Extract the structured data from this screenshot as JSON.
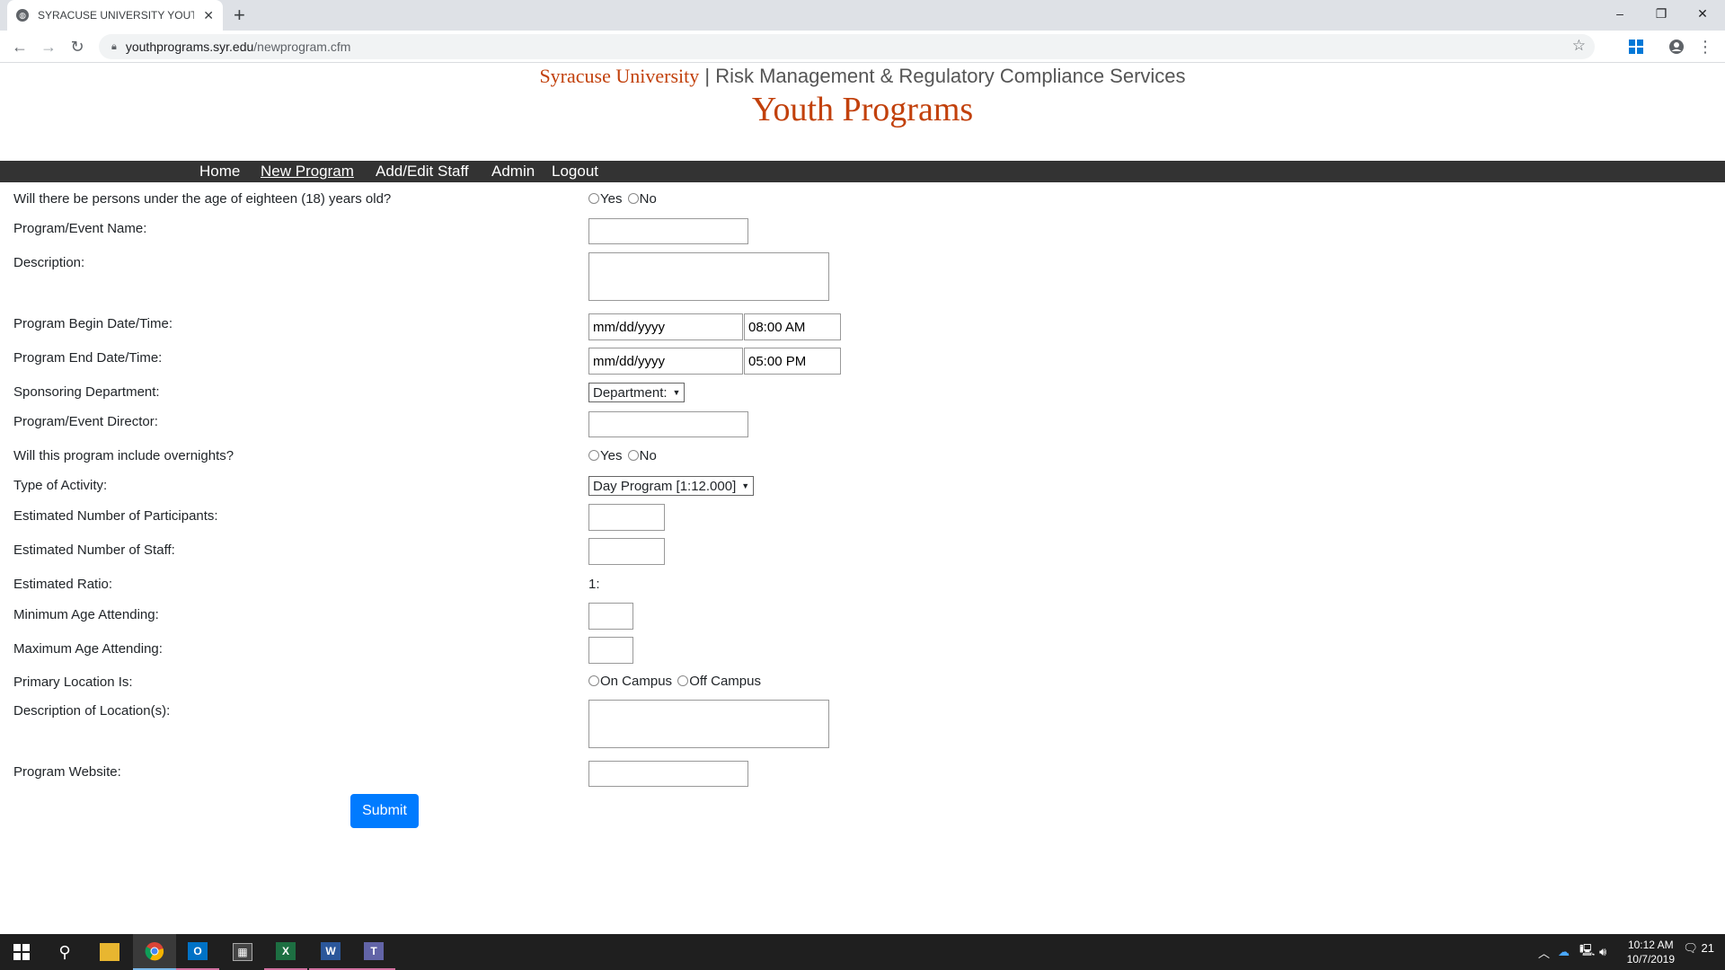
{
  "browser": {
    "tab_title": "SYRACUSE UNIVERSITY YOUTH P",
    "tab_close": "✕",
    "new_tab": "+",
    "url_host": "youthprograms.syr.edu",
    "url_path": "/newprogram.cfm",
    "window_controls": [
      "–",
      "❐",
      "✕"
    ]
  },
  "header": {
    "brand": "Syracuse University",
    "separator": "|",
    "department": "Risk Management & Regulatory Compliance Services",
    "title": "Youth Programs"
  },
  "nav": [
    "Home",
    "New Program",
    "Add/Edit Staff",
    "Admin",
    "Logout"
  ],
  "form": {
    "under18_label": "Will there be persons under the age of eighteen (18) years old?",
    "yes": "Yes",
    "no": "No",
    "program_name_label": "Program/Event Name:",
    "description_label": "Description:",
    "begin_label": "Program Begin Date/Time:",
    "begin_date": "mm/dd/yyyy",
    "begin_time": "08:00 AM",
    "end_label": "Program End Date/Time:",
    "end_date": "mm/dd/yyyy",
    "end_time": "05:00 PM",
    "sponsor_label": "Sponsoring Department:",
    "sponsor_value": "Department:",
    "director_label": "Program/Event Director:",
    "overnights_label": "Will this program include overnights?",
    "activity_label": "Type of Activity:",
    "activity_value": "Day Program [1:12.000]",
    "participants_label": "Estimated Number of Participants:",
    "staff_label": "Estimated Number of Staff:",
    "ratio_label": "Estimated Ratio:",
    "ratio_value": "1:",
    "min_age_label": "Minimum Age Attending:",
    "max_age_label": "Maximum Age Attending:",
    "location_label": "Primary Location Is:",
    "on_campus": "On Campus",
    "off_campus": "Off Campus",
    "location_desc_label": "Description of Location(s):",
    "website_label": "Program Website:",
    "submit": "Submit"
  },
  "taskbar": {
    "time": "10:12 AM",
    "date": "10/7/2019",
    "notifications": "21"
  }
}
